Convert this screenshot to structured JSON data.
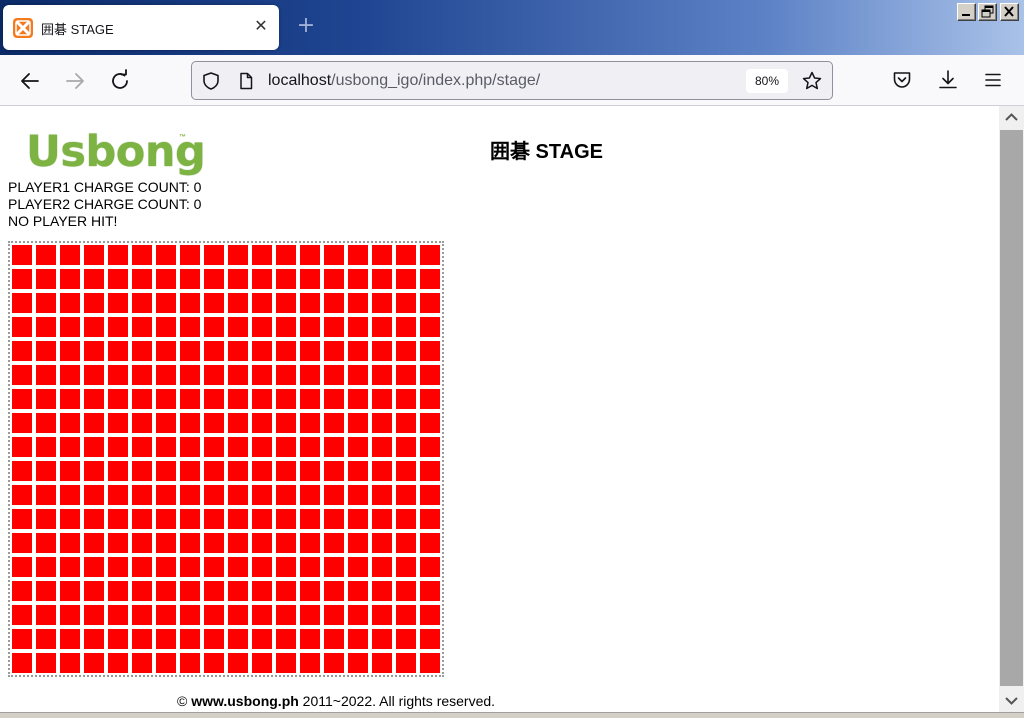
{
  "browser": {
    "tab": {
      "title": "囲碁 STAGE",
      "favicon": "xampp-icon",
      "close_glyph": "✕"
    },
    "new_tab_glyph": "+",
    "url": {
      "host": "localhost",
      "path": "/usbong_igo/index.php/stage/"
    },
    "zoom": "80%"
  },
  "page": {
    "logo": {
      "text": "Usbong",
      "tm": "™",
      "color": "#7cb342"
    },
    "title": "囲碁 STAGE",
    "status": {
      "player1": "PLAYER1 CHARGE COUNT: 0",
      "player2": "PLAYER2 CHARGE COUNT: 0",
      "hit": "NO PLAYER HIT!"
    },
    "board": {
      "rows": 18,
      "cols": 18,
      "cell_color": "#ff0000"
    },
    "footer": {
      "copyright": "© ",
      "site": "www.usbong.ph",
      "rest": " 2011~2022. All rights reserved."
    }
  }
}
